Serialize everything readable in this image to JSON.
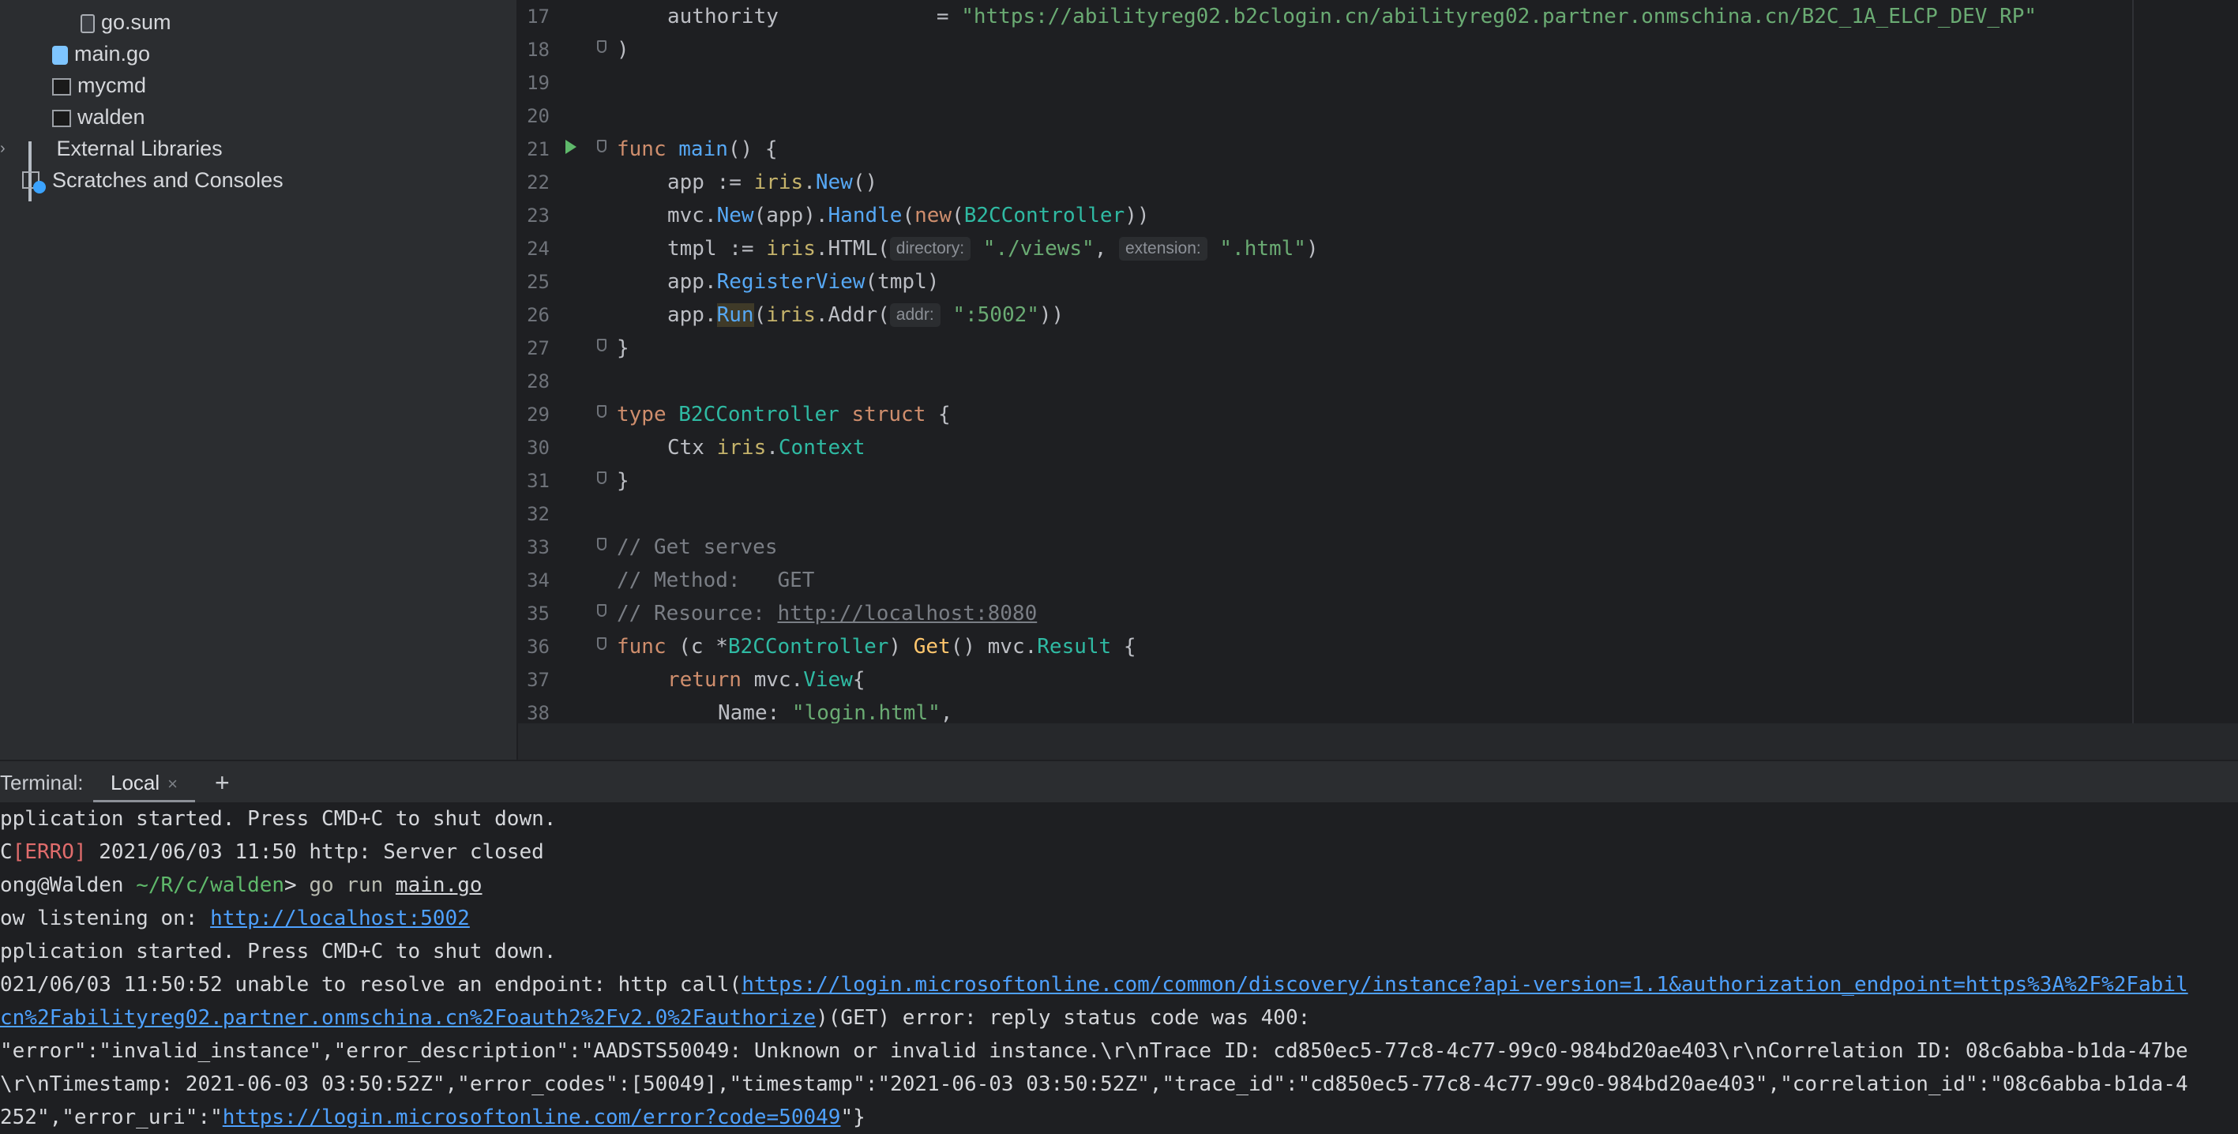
{
  "project_tree": {
    "items": [
      {
        "label": "go.sum",
        "icon": "file-icon"
      },
      {
        "label": "main.go",
        "icon": "go-file-icon"
      },
      {
        "label": "mycmd",
        "icon": "executable-icon"
      },
      {
        "label": "walden",
        "icon": "executable-icon"
      },
      {
        "label": "External Libraries",
        "icon": "library-icon"
      },
      {
        "label": "Scratches and Consoles",
        "icon": "scratches-icon"
      }
    ]
  },
  "editor": {
    "line_numbers": [
      "17",
      "18",
      "19",
      "20",
      "21",
      "22",
      "23",
      "24",
      "25",
      "26",
      "27",
      "28",
      "29",
      "30",
      "31",
      "32",
      "33",
      "34",
      "35",
      "36",
      "37",
      "38"
    ],
    "l17": {
      "field": "authority",
      "eq": "= ",
      "value": "\"https://abilityreg02.b2clogin.cn/abilityreg02.partner.onmschina.cn/B2C_1A_ELCP_DEV_RP\""
    },
    "l18": ")",
    "l21": {
      "kw": "func",
      "name": "main",
      "rest": "() {"
    },
    "l22": {
      "a": "app := ",
      "pkg": "iris",
      "dot": ".",
      "fn": "New",
      "end": "()"
    },
    "l23": {
      "a": "mvc.",
      "fn": "New",
      "b": "(app).",
      "fn2": "Handle",
      "c": "(",
      "kw": "new",
      "d": "(",
      "type": "B2CController",
      "e": "))"
    },
    "l24": {
      "a": "tmpl := ",
      "pkg": "iris",
      "b": ".HTML(",
      "hint1": "directory:",
      "s1": "\"./views\"",
      "sep": ", ",
      "hint2": "extension:",
      "s2": "\".html\"",
      "end": ")"
    },
    "l25": {
      "a": "app.",
      "fn": "RegisterView",
      "b": "(tmpl)"
    },
    "l26": {
      "a": "app.",
      "fn": "Run",
      "b": "(",
      "pkg": "iris",
      "c": ".Addr(",
      "hint": "addr:",
      "s": "\":5002\"",
      "end": "))"
    },
    "l27": "}",
    "l29": {
      "kw": "type",
      "name": " B2CController ",
      "kw2": "struct",
      "rest": " {"
    },
    "l30": {
      "a": "Ctx ",
      "pkg": "iris",
      "dot": ".",
      "type": "Context"
    },
    "l31": "}",
    "l33": "// Get serves",
    "l34": "// Method:   GET",
    "l35": {
      "prefix": "// Resource: ",
      "link": "http://localhost:8080"
    },
    "l36": {
      "kw": "func",
      "a": " (c *",
      "type": "B2CController",
      "b": ") ",
      "fn": "Get",
      "c": "() mvc.",
      "type2": "Result",
      "d": " {"
    },
    "l37": {
      "kw": "return",
      "a": " mvc.",
      "type": "View",
      "b": "{"
    },
    "l38": {
      "a": "Name: ",
      "s": "\"login.html\"",
      "b": ","
    }
  },
  "terminal": {
    "title": "Terminal:",
    "tab_label": "Local",
    "close_glyph": "×",
    "add_glyph": "+",
    "lines": {
      "l1": "pplication started. Press CMD+C to shut down.",
      "l2_prefix": "C",
      "l2_err": "[ERRO]",
      "l2_rest": " 2021/06/03 11:50 http: Server closed",
      "l3_user": "ong@Walden ",
      "l3_path": "~/R/c/walden",
      "l3_gt": "> ",
      "l3_cmd": "go run ",
      "l3_file": "main.go",
      "l4_prefix": "ow listening on: ",
      "l4_link": "http://localhost:5002",
      "l5": "pplication started. Press CMD+C to shut down.",
      "l6_prefix": "021/06/03 11:50:52 unable to resolve an endpoint: http call(",
      "l6_link": "https://login.microsoftonline.com/common/discovery/instance?api-version=1.1&authorization_endpoint=https%3A%2F%2Fabil",
      "l7_link": "cn%2Fabilityreg02.partner.onmschina.cn%2Foauth2%2Fv2.0%2Fauthorize",
      "l7_rest": ")(GET) error: reply status code was 400:",
      "l8": "\"error\":\"invalid_instance\",\"error_description\":\"AADSTS50049: Unknown or invalid instance.\\r\\nTrace ID: cd850ec5-77c8-4c77-99c0-984bd20ae403\\r\\nCorrelation ID: 08c6abba-b1da-47be",
      "l9": "\\r\\nTimestamp: 2021-06-03 03:50:52Z\",\"error_codes\":[50049],\"timestamp\":\"2021-06-03 03:50:52Z\",\"trace_id\":\"cd850ec5-77c8-4c77-99c0-984bd20ae403\",\"correlation_id\":\"08c6abba-b1da-4",
      "l10_prefix": "252\",\"error_uri\":\"",
      "l10_link": "https://login.microsoftonline.com/error?code=50049",
      "l10_rest": "\"}"
    }
  }
}
